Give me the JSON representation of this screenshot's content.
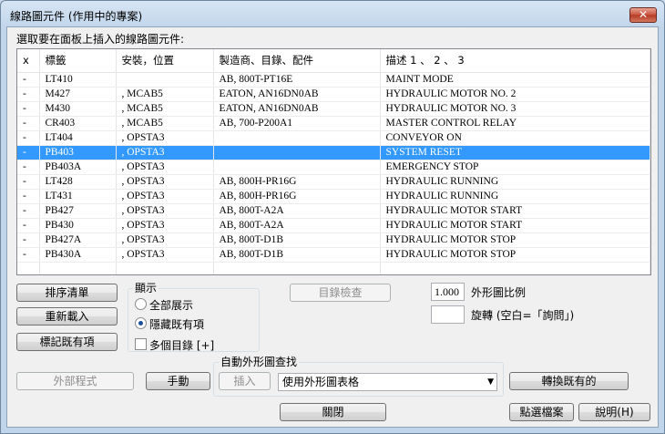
{
  "window": {
    "title": "線路圖元件 (作用中的專案)",
    "close_glyph": "✕"
  },
  "prompt": "選取要在面板上插入的線路圖元件:",
  "table": {
    "headers": [
      "x",
      "標籤",
      "安裝，位置",
      "製造商、目錄、配件",
      "描述 1 、 2 、 3"
    ],
    "rows": [
      [
        "-",
        "LT410",
        "",
        "AB, 800T-PT16E",
        "MAINT MODE"
      ],
      [
        "-",
        "M427",
        ", MCAB5",
        "EATON, AN16DN0AB",
        "HYDRAULIC MOTOR NO. 2"
      ],
      [
        "-",
        "M430",
        ", MCAB5",
        "EATON, AN16DN0AB",
        "HYDRAULIC MOTOR NO. 3"
      ],
      [
        "-",
        "CR403",
        ", MCAB5",
        "AB, 700-P200A1",
        "MASTER CONTROL RELAY"
      ],
      [
        "-",
        "LT404",
        ", OPSTA3",
        "",
        "CONVEYOR ON"
      ],
      [
        "-",
        "PB403",
        ", OPSTA3",
        "",
        "SYSTEM RESET"
      ],
      [
        "-",
        "PB403A",
        ", OPSTA3",
        "",
        "EMERGENCY STOP"
      ],
      [
        "-",
        "LT428",
        ", OPSTA3",
        "AB, 800H-PR16G",
        "HYDRAULIC RUNNING"
      ],
      [
        "-",
        "LT431",
        ", OPSTA3",
        "AB, 800H-PR16G",
        "HYDRAULIC RUNNING"
      ],
      [
        "-",
        "PB427",
        ", OPSTA3",
        "AB, 800T-A2A",
        "HYDRAULIC MOTOR START"
      ],
      [
        "-",
        "PB430",
        ", OPSTA3",
        "AB, 800T-A2A",
        "HYDRAULIC MOTOR START"
      ],
      [
        "-",
        "PB427A",
        ", OPSTA3",
        "AB, 800T-D1B",
        "HYDRAULIC MOTOR STOP"
      ],
      [
        "-",
        "PB430A",
        ", OPSTA3",
        "AB, 800T-D1B",
        "HYDRAULIC MOTOR STOP"
      ]
    ],
    "selected_row": 5
  },
  "left_buttons": {
    "sort": "排序清單",
    "reload": "重新載入",
    "mark_existing": "標記既有項"
  },
  "display_group": {
    "label": "顯示",
    "show_all": "全部展示",
    "hide_existing": "隱藏既有項",
    "selected": "hide_existing",
    "multi_catalog": "多個目錄 [+]",
    "multi_catalog_checked": false
  },
  "catalog_check": "目錄檢查",
  "scale": {
    "value": "1.000",
    "label": "外形圖比例"
  },
  "rotate": {
    "value": "",
    "label": "旋轉 (空白=「詢問」)"
  },
  "external_program": "外部程式",
  "manual": "手動",
  "auto_lookup": {
    "label": "自動外形圖查找",
    "insert": "插入",
    "combo_value": "使用外形圖表格",
    "combo_arrow": "▼"
  },
  "convert_existing": "轉換既有的",
  "close": "關閉",
  "pick_file": "點選檔案",
  "help": "說明(H)",
  "colors": {
    "selection": "#3399ff",
    "window_frame": "#c1d5ea",
    "close_button": "#c9503a"
  }
}
